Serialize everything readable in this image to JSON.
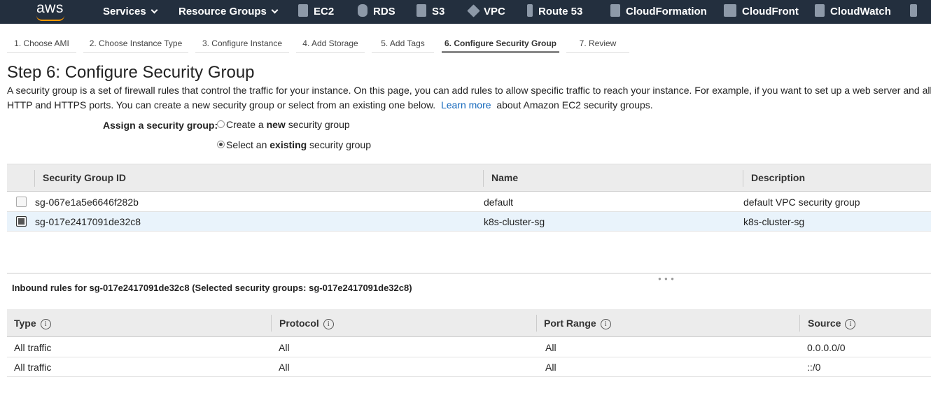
{
  "topnav": {
    "logo": "aws",
    "services": "Services",
    "resource_groups": "Resource Groups",
    "shortcuts": [
      {
        "label": "EC2",
        "icon": "ec2-icon"
      },
      {
        "label": "RDS",
        "icon": "rds-icon"
      },
      {
        "label": "S3",
        "icon": "s3-icon"
      },
      {
        "label": "VPC",
        "icon": "vpc-icon"
      },
      {
        "label": "Route 53",
        "icon": "route53-icon"
      },
      {
        "label": "CloudFormation",
        "icon": "cloudformation-icon"
      },
      {
        "label": "CloudFront",
        "icon": "cloudfront-icon"
      },
      {
        "label": "CloudWatch",
        "icon": "cloudwatch-icon"
      }
    ]
  },
  "wizard": {
    "tabs": [
      "1. Choose AMI",
      "2. Choose Instance Type",
      "3. Configure Instance",
      "4. Add Storage",
      "5. Add Tags",
      "6. Configure Security Group",
      "7. Review"
    ],
    "active_tab": "6. Configure Security Group"
  },
  "page": {
    "title": "Step 6: Configure Security Group",
    "intro_1": "A security group is a set of firewall rules that control the traffic for your instance. On this page, you can add rules to allow specific traffic to reach your instance. For example, if you want to set up a web server and all",
    "intro_2": "HTTP and HTTPS ports. You can create a new security group or select from an existing one below.",
    "learn_more": "Learn more",
    "intro_3": "about Amazon EC2 security groups."
  },
  "assign": {
    "label": "Assign a security group:",
    "option_new_pre": "Create a ",
    "option_new_bold": "new",
    "option_new_post": " security group",
    "option_existing_pre": "Select an ",
    "option_existing_bold": "existing",
    "option_existing_post": " security group",
    "selected": "existing"
  },
  "sg_table": {
    "headers": [
      "Security Group ID",
      "Name",
      "Description"
    ],
    "rows": [
      {
        "id": "sg-067e1a5e6646f282b",
        "name": "default",
        "description": "default VPC security group",
        "selected": false
      },
      {
        "id": "sg-017e2417091de32c8",
        "name": "k8s-cluster-sg",
        "description": "k8s-cluster-sg",
        "selected": true
      }
    ]
  },
  "inbound": {
    "title": "Inbound rules for sg-017e2417091de32c8 (Selected security groups: sg-017e2417091de32c8)",
    "headers": [
      "Type",
      "Protocol",
      "Port Range",
      "Source"
    ],
    "rows": [
      {
        "type": "All traffic",
        "protocol": "All",
        "port_range": "All",
        "source": "0.0.0.0/0"
      },
      {
        "type": "All traffic",
        "protocol": "All",
        "port_range": "All",
        "source": "::/0"
      }
    ]
  }
}
